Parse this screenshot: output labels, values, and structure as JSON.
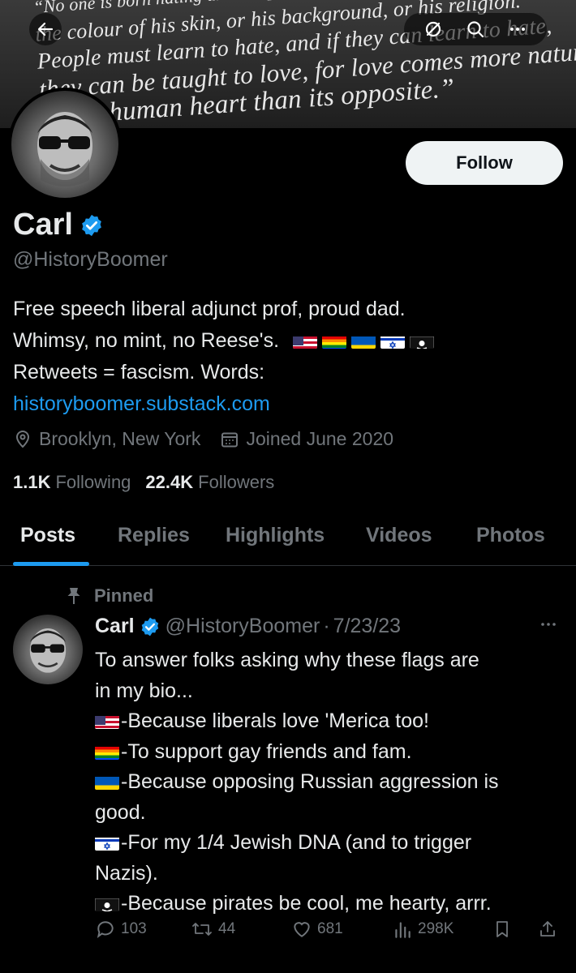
{
  "banner": {
    "quote_lines": [
      "“No one is born hating another person because of",
      "the colour of his skin, or his background, or his religion.",
      "People must learn to hate, and if they can learn to hate,",
      "they can be taught to love, for love comes more naturally",
      "to the human heart than its opposite.”"
    ]
  },
  "toolbar": {
    "back_icon": "arrow-left-icon",
    "icons": [
      "grok-icon",
      "search-icon",
      "more-icon"
    ]
  },
  "profile": {
    "follow_label": "Follow",
    "name": "Carl",
    "handle": "@HistoryBoomer",
    "bio_line1": "Free speech liberal adjunct prof, proud dad.",
    "bio_line2": "Whimsy, no mint, no Reese's.",
    "bio_flags": [
      "us-flag",
      "rainbow-flag",
      "ukraine-flag",
      "israel-flag",
      "pirate-flag"
    ],
    "bio_line3": "Retweets = fascism. Words:",
    "bio_link": "historyboomer.substack.com",
    "location": "Brooklyn, New York",
    "joined": "Joined June 2020",
    "following_count": "1.1K",
    "following_label": "Following",
    "followers_count": "22.4K",
    "followers_label": "Followers",
    "verified_color": "#1d9bf0"
  },
  "tabs": [
    {
      "label": "Posts",
      "active": true
    },
    {
      "label": "Replies",
      "active": false
    },
    {
      "label": "Highlights",
      "active": false
    },
    {
      "label": "Videos",
      "active": false
    },
    {
      "label": "Photos",
      "active": false
    }
  ],
  "post": {
    "pinned_label": "Pinned",
    "author": "Carl",
    "handle": "@HistoryBoomer",
    "sep": "·",
    "date": "7/23/23",
    "lines": [
      "To answer folks asking why these flags are",
      "in my bio...",
      "-Because liberals love 'Merica too!",
      "-To support gay friends and fam.",
      "-Because opposing Russian aggression is",
      "good.",
      "-For my 1/4 Jewish DNA (and to trigger",
      "Nazis).",
      "-Because pirates be cool, me hearty, arrr."
    ],
    "replies": "103",
    "reposts": "44",
    "likes": "681",
    "views": "298K"
  }
}
